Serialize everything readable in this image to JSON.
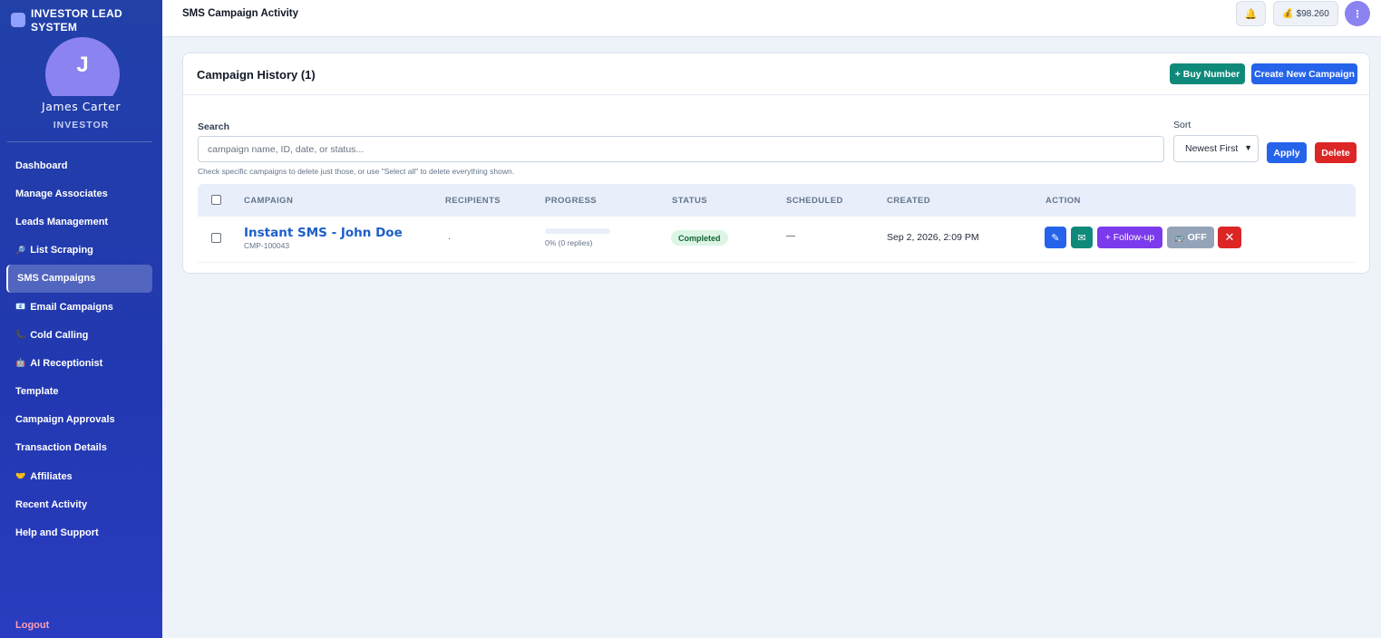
{
  "brand": {
    "name": "INVESTOR LEAD SYSTEM"
  },
  "user": {
    "initial": "J",
    "name": "James Carter",
    "role": "INVESTOR"
  },
  "sidebar": {
    "items": [
      {
        "label": "Dashboard",
        "icon": ""
      },
      {
        "label": "Manage Associates",
        "icon": ""
      },
      {
        "label": "Leads Management",
        "icon": ""
      },
      {
        "label": "List Scraping",
        "icon": "🔎"
      },
      {
        "label": "SMS Campaigns",
        "icon": ""
      },
      {
        "label": "Email Campaigns",
        "icon": "📧"
      },
      {
        "label": "Cold Calling",
        "icon": "📞"
      },
      {
        "label": "AI Receptionist",
        "icon": "🤖"
      },
      {
        "label": "Template",
        "icon": ""
      },
      {
        "label": "Campaign Approvals",
        "icon": ""
      },
      {
        "label": "Transaction Details",
        "icon": ""
      },
      {
        "label": "Affiliates",
        "icon": "🤝"
      },
      {
        "label": "Recent Activity",
        "icon": ""
      },
      {
        "label": "Help and Support",
        "icon": ""
      }
    ],
    "active_index": 4,
    "logout": "Logout"
  },
  "topbar": {
    "title": "SMS Campaign Activity",
    "bell_icon": "🔔",
    "balance_icon": "💰",
    "balance": "$98.260",
    "avatar_glyph": "⋮"
  },
  "card": {
    "title": "Campaign History (1)",
    "buy_number": "+ Buy Number",
    "create_campaign": "Create New Campaign"
  },
  "search": {
    "label": "Search",
    "placeholder": "campaign name, ID, date, or status...",
    "value": "",
    "hint": "Check specific campaigns to delete just those, or use \"Select all\" to delete everything shown."
  },
  "sort": {
    "label": "Sort",
    "selected": "Newest First",
    "apply": "Apply",
    "delete": "Delete"
  },
  "table": {
    "headers": [
      "CAMPAIGN",
      "RECIPIENTS",
      "PROGRESS",
      "STATUS",
      "SCHEDULED",
      "CREATED",
      "ACTION"
    ],
    "rows": [
      {
        "name": "Instant SMS - John Doe",
        "id": "CMP-100043",
        "recipients": ".",
        "progress_fraction": 0,
        "progress_text": "0% (0 replies)",
        "status": "Completed",
        "scheduled": "—",
        "created": "Sep 2, 2026, 2:09 PM",
        "actions": {
          "edit": "✎",
          "mail": "✉",
          "follow_up": "+ Follow-up",
          "off_icon": "🚌",
          "off": "OFF",
          "delete": "✕"
        }
      }
    ]
  },
  "colors": {
    "sidebar": "#2238b0",
    "primary": "#2563eb",
    "teal": "#0f8a7a",
    "purple": "#7c3aed",
    "danger": "#dc2626",
    "status_bg": "#dcf5e4",
    "status_text": "#166534"
  }
}
